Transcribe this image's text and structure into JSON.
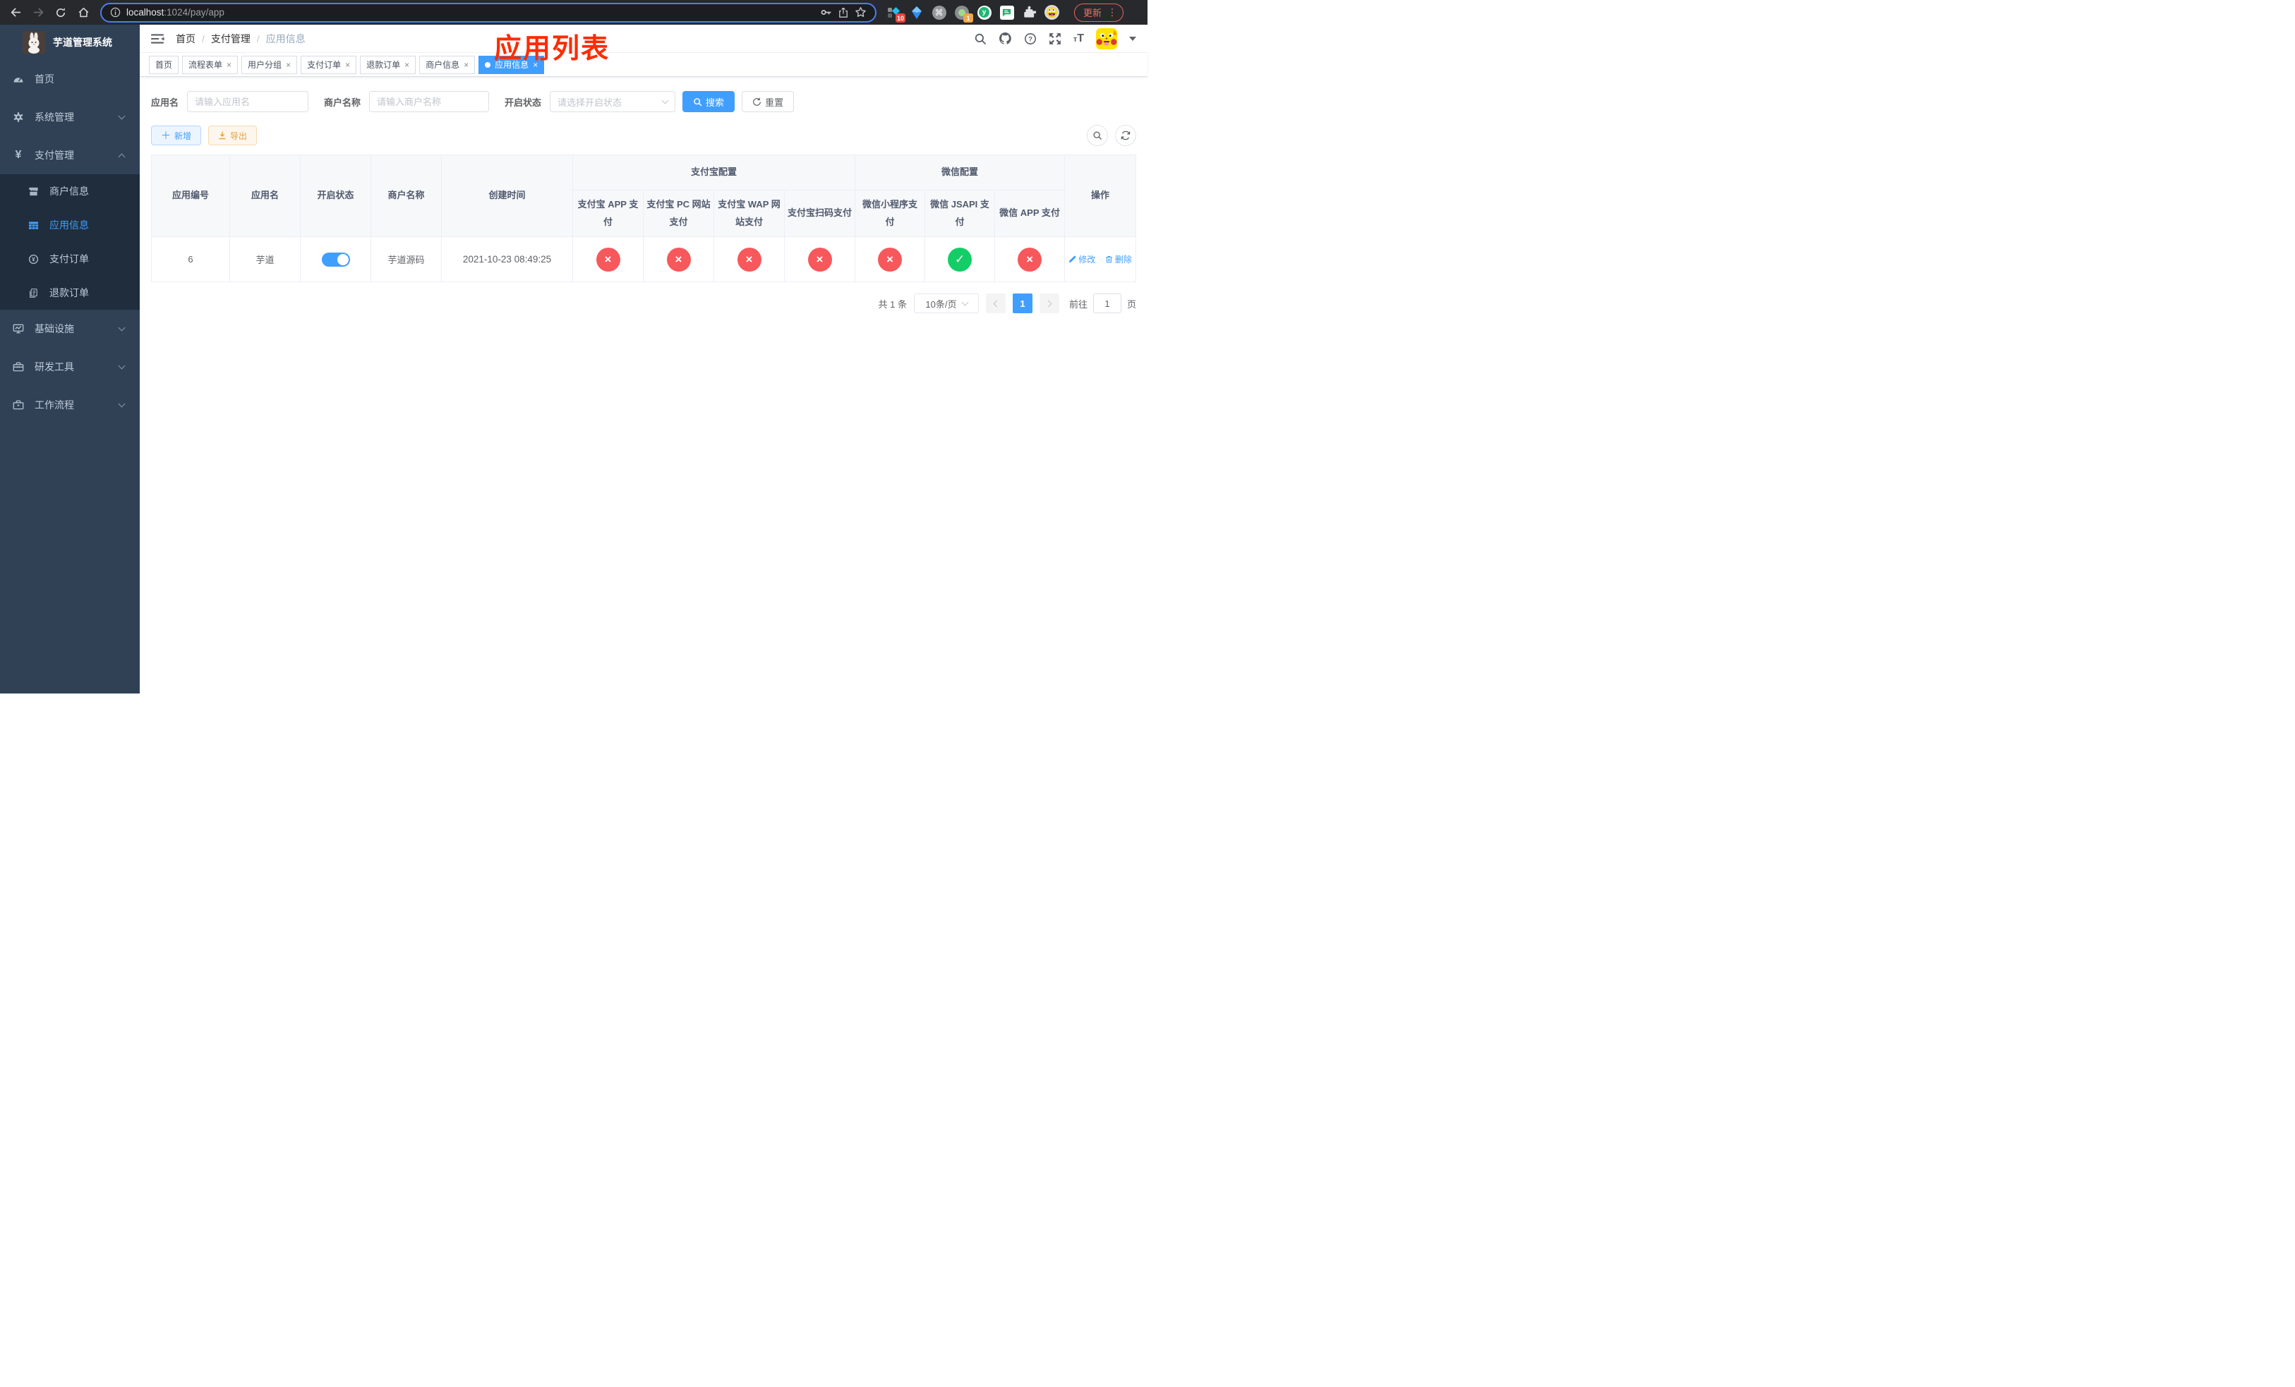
{
  "colors": {
    "primary": "#409eff",
    "success": "#13ce66",
    "danger": "#f7585c",
    "warning": "#e6a23c",
    "annotation_red": "#fe2b00",
    "sidebar_bg": "#304156",
    "submenu_bg": "#1f2d3d"
  },
  "browser": {
    "url_host": "localhost",
    "url_path": ":1024/pay/app",
    "update_label": "更新",
    "ext_badge_1": "10",
    "ext_badge_2": "1"
  },
  "sidebar": {
    "title": "芋道管理系统",
    "items": [
      {
        "label": "首页"
      },
      {
        "label": "系统管理"
      },
      {
        "label": "支付管理"
      },
      {
        "label": "商户信息"
      },
      {
        "label": "应用信息"
      },
      {
        "label": "支付订单"
      },
      {
        "label": "退款订单"
      },
      {
        "label": "基础设施"
      },
      {
        "label": "研发工具"
      },
      {
        "label": "工作流程"
      }
    ]
  },
  "navbar": {
    "breadcrumb": [
      "首页",
      "支付管理",
      "应用信息"
    ]
  },
  "annotation": {
    "text": "应用列表"
  },
  "tabs": [
    {
      "label": "首页"
    },
    {
      "label": "流程表单"
    },
    {
      "label": "用户分组"
    },
    {
      "label": "支付订单"
    },
    {
      "label": "退款订单"
    },
    {
      "label": "商户信息"
    },
    {
      "label": "应用信息"
    }
  ],
  "filters": {
    "app_name_label": "应用名",
    "app_name_placeholder": "请输入应用名",
    "merchant_label": "商户名称",
    "merchant_placeholder": "请输入商户名称",
    "status_label": "开启状态",
    "status_placeholder": "请选择开启状态",
    "search_label": "搜索",
    "reset_label": "重置"
  },
  "toolbar": {
    "add_label": "新增",
    "export_label": "导出"
  },
  "table": {
    "columns": [
      "应用编号",
      "应用名",
      "开启状态",
      "商户名称",
      "创建时间"
    ],
    "groups": [
      {
        "title": "支付宝配置"
      },
      {
        "title": "微信配置"
      }
    ],
    "sub_columns": [
      "支付宝 APP 支付",
      "支付宝 PC 网站支付",
      "支付宝 WAP 网站支付",
      "支付宝扫码支付",
      "微信小程序支付",
      "微信 JSAPI 支付",
      "微信 APP 支付"
    ],
    "ops_column": "操作",
    "check_glyph": "✓",
    "cross_glyph": "×",
    "row": {
      "id": "6",
      "name": "芋道",
      "enabled": true,
      "merchant": "芋道源码",
      "created": "2021-10-23 08:49:25",
      "statuses": [
        false,
        false,
        false,
        false,
        false,
        true,
        false
      ],
      "edit_label": "修改",
      "delete_label": "删除"
    }
  },
  "pagination": {
    "total": "共 1 条",
    "page_size": "10条/页",
    "page": "1",
    "goto_prefix": "前往",
    "goto_suffix": "页",
    "goto_value": "1"
  }
}
